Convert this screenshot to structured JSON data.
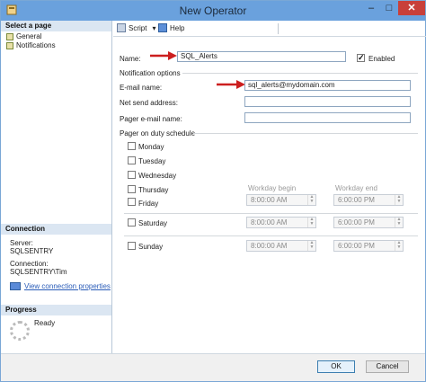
{
  "window": {
    "title": "New Operator",
    "minimize": "–",
    "maximize": "□",
    "close": "✕"
  },
  "left_pane": {
    "select_page_header": "Select a page",
    "pages": [
      "General",
      "Notifications"
    ],
    "connection_header": "Connection",
    "server_label": "Server:",
    "server_value": "SQLSENTRY",
    "connection_label": "Connection:",
    "connection_value": "SQLSENTRY\\Tim",
    "view_connection_properties": "View connection properties",
    "progress_header": "Progress",
    "progress_status": "Ready"
  },
  "toolbar": {
    "script_label": "Script",
    "script_dropdown": "▾",
    "help_label": "Help"
  },
  "form": {
    "name_label": "Name:",
    "name_value": "SQL_Alerts",
    "enabled_label": "Enabled",
    "enabled_checked": true,
    "notification_options_label": "Notification options",
    "email_label": "E-mail name:",
    "email_value": "sql_alerts@mydomain.com",
    "net_send_label": "Net send address:",
    "net_send_value": "",
    "pager_email_label": "Pager e-mail name:",
    "pager_email_value": "",
    "pager_schedule_label": "Pager on duty schedule",
    "days": [
      "Monday",
      "Tuesday",
      "Wednesday",
      "Thursday",
      "Friday"
    ],
    "saturday": "Saturday",
    "sunday": "Sunday",
    "workday_begin_label": "Workday begin",
    "workday_end_label": "Workday end",
    "begin_time": "8:00:00 AM",
    "end_time": "6:00:00 PM",
    "spin_up": "▲",
    "spin_down": "▼"
  },
  "buttons": {
    "ok": "OK",
    "cancel": "Cancel"
  },
  "colors": {
    "titlebar": "#6aa1dd",
    "close_button": "#c8403a",
    "arrow": "#cc1f1f",
    "link": "#2a5cb8"
  }
}
